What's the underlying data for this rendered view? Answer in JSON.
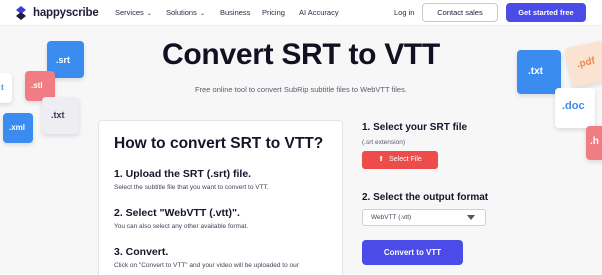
{
  "header": {
    "brand": "happyscribe",
    "nav": [
      {
        "label": "Services",
        "dropdown": true
      },
      {
        "label": "Solutions",
        "dropdown": true
      },
      {
        "label": "Business",
        "dropdown": false
      },
      {
        "label": "Pricing",
        "dropdown": false
      },
      {
        "label": "AI Accuracy",
        "dropdown": false
      }
    ],
    "login": "Log in",
    "contact": "Contact sales",
    "cta": "Get started free"
  },
  "hero": {
    "title": "Convert SRT to VTT",
    "subtitle": "Free online tool to convert SubRip subtitle files to WebVTT files."
  },
  "tiles": {
    "srt": ".srt",
    "stl": ".stl",
    "xml": ".xml",
    "txt_left": ".txt",
    "txt_right": ".txt",
    "pdf": ".pdf",
    "doc": ".doc",
    "h": ".h",
    "t": "t"
  },
  "guide": {
    "title": "How to convert SRT to VTT?",
    "steps": [
      {
        "heading": "1. Upload the SRT (.srt) file.",
        "text": "Select the subtitle file that you want to convert to VTT."
      },
      {
        "heading": "2. Select \"WebVTT (.vtt)\".",
        "text": "You can also select any other available format."
      },
      {
        "heading": "3. Convert.",
        "text": "Click on \"Convert to VTT\" and your video will be uploaded to our"
      }
    ]
  },
  "form": {
    "step1_label": "1.  Select your SRT file",
    "step1_ext": "(.srt extension)",
    "select_file": "Select File",
    "step2_label": "2.  Select the output format",
    "format_value": "WebVTT (.vtt)",
    "convert": "Convert to VTT"
  },
  "colors": {
    "accent": "#4b4be8",
    "select_file": "#ee4b4b"
  }
}
